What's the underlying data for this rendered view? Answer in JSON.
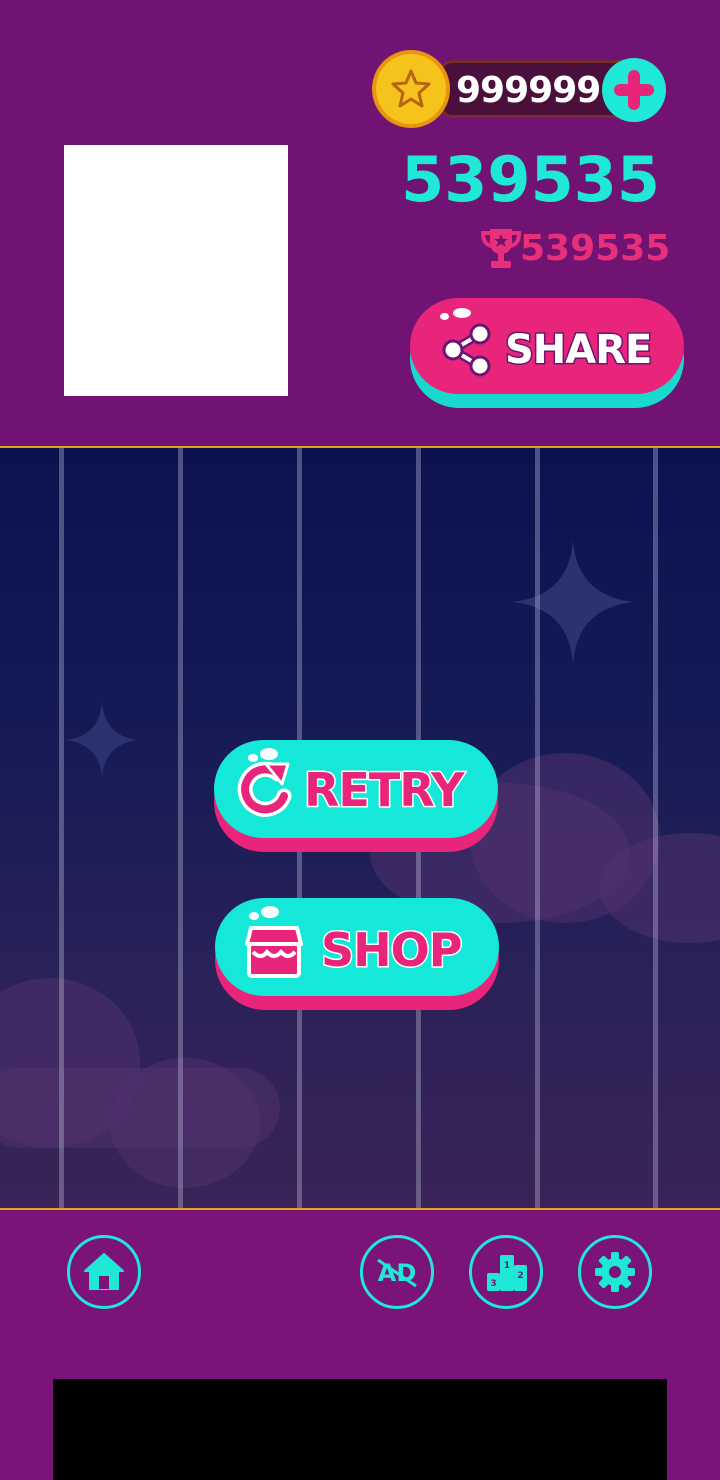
{
  "coins": {
    "value": "999999",
    "icon": "star-coin-icon",
    "add_icon": "plus-icon"
  },
  "score": {
    "current": "539535",
    "best": "539535",
    "best_icon": "trophy-icon"
  },
  "share_button": {
    "label": "SHARE",
    "icon": "share-icon"
  },
  "retry_button": {
    "label": "RETRY",
    "icon": "refresh-icon"
  },
  "shop_button": {
    "label": "SHOP",
    "icon": "store-icon"
  },
  "footer": {
    "home_icon": "home-icon",
    "no_ads_icon": "no-ads-icon",
    "no_ads_text": "AD",
    "leaderboard_icon": "podium-icon",
    "leaderboard_places": [
      "1",
      "2",
      "3"
    ],
    "settings_icon": "gear-icon"
  },
  "colors": {
    "accent_cyan": "#1fe8d6",
    "accent_pink": "#e8257a",
    "header_purple": "#701372",
    "night_blue": "#0c1250",
    "gold": "#f6c21c"
  }
}
